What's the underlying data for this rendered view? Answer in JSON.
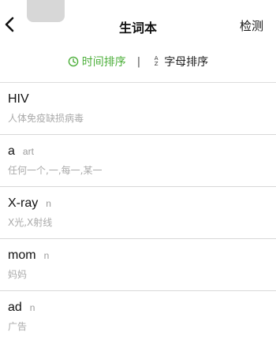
{
  "header": {
    "title": "生词本",
    "check_label": "检测"
  },
  "sort": {
    "time_label": "时间排序",
    "alpha_label": "字母排序",
    "alpha_icon_top": "A",
    "alpha_icon_bottom": "Z",
    "active": "time",
    "active_color": "#4caf3a"
  },
  "words": [
    {
      "word": "HIV",
      "pos": "",
      "meaning": "人体免疫缺损病毒"
    },
    {
      "word": "a",
      "pos": "art",
      "meaning": "任何一个,一,每一,某一"
    },
    {
      "word": "X-ray",
      "pos": "n",
      "meaning": "X光,X射线"
    },
    {
      "word": "mom",
      "pos": "n",
      "meaning": "妈妈"
    },
    {
      "word": "ad",
      "pos": "n",
      "meaning": "广告"
    }
  ]
}
